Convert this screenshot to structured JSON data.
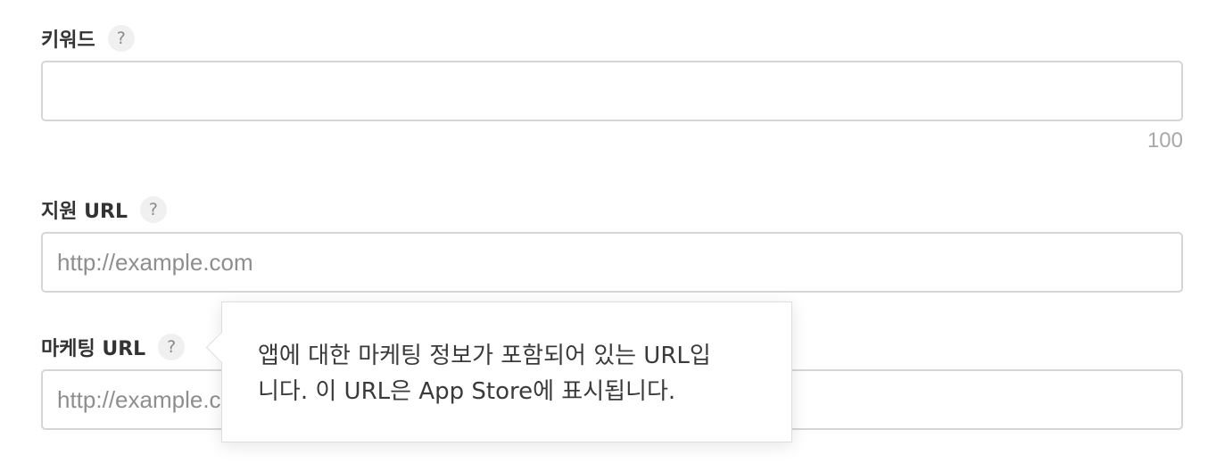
{
  "keywords": {
    "label": "키워드",
    "help": "?",
    "value": "",
    "placeholder": "",
    "char_count": "100"
  },
  "support_url": {
    "label": "지원 URL",
    "help": "?",
    "value": "",
    "placeholder": "http://example.com"
  },
  "marketing_url": {
    "label": "마케팅 URL",
    "help": "?",
    "value": "",
    "placeholder": "http://example.com"
  },
  "tooltip": {
    "line1": "앱에 대한 마케팅 정보가 포함되어 있는 URL입",
    "line2": "니다. 이 URL은 App Store에 표시됩니다."
  }
}
